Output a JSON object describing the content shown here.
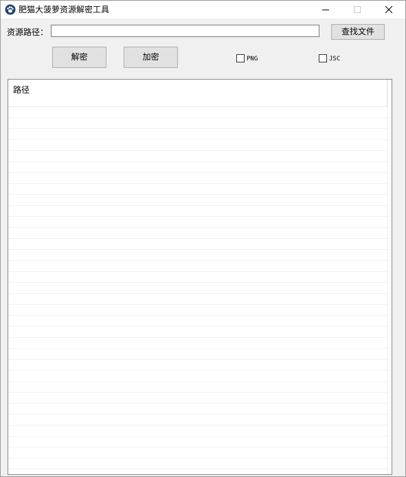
{
  "window": {
    "title": "肥猫大菠萝资源解密工具",
    "icon": "paw-icon",
    "controls": [
      "minimize-icon",
      "maximize-icon",
      "close-icon"
    ]
  },
  "path": {
    "label": "资源路径：",
    "value": "",
    "placeholder": ""
  },
  "buttons": {
    "browse": "查找文件",
    "decrypt": "解密",
    "encrypt": "加密"
  },
  "options": {
    "png": {
      "label": "PNG",
      "checked": false
    },
    "jsc": {
      "label": "JSC",
      "checked": false
    }
  },
  "list": {
    "columns": [
      "路径"
    ],
    "rows": []
  },
  "colors": {
    "window_bg": "#f0f0f0",
    "titlebar_bg": "#ffffff",
    "button_bg": "#e1e1e1",
    "button_border": "#adadad"
  }
}
